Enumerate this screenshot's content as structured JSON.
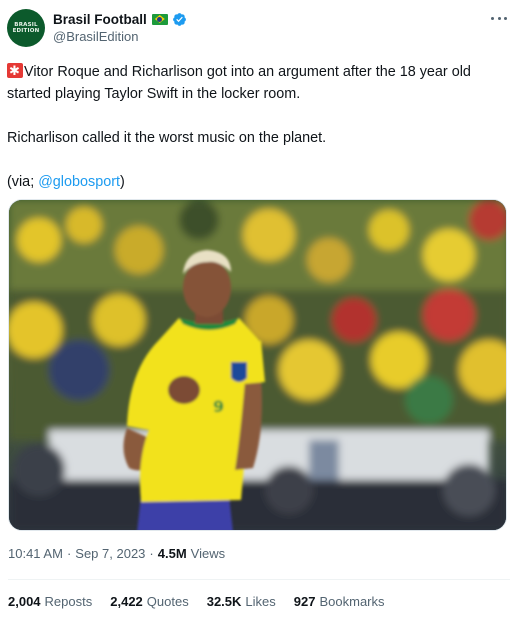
{
  "author": {
    "display_name": "Brasil Football",
    "handle": "@BrasilEdition",
    "avatar_text": "BRASIL EDITION",
    "flag_icon": "brazil-flag-icon",
    "verified_icon": "verified-badge-icon",
    "verified_color": "#1d9bf0"
  },
  "tweet": {
    "line1_text": "Vitor Roque and Richarlison got into an argument after the 18 year old started playing Taylor Swift in the locker room.",
    "line2_text": "Richarlison called it the worst music on the planet.",
    "via_prefix": "(via; ",
    "via_mention": "@globosport",
    "via_suffix": ")",
    "siren_icon": "siren-icon",
    "mention_color": "#1d9bf0"
  },
  "media": {
    "description_icon": "photo-footballer-yellow-jersey",
    "jersey_number": "9"
  },
  "meta": {
    "time": "10:41 AM",
    "date": "Sep 7, 2023",
    "separator": "·",
    "views_count": "4.5M",
    "views_label": "Views"
  },
  "stats": [
    {
      "count": "2,004",
      "label": "Reposts"
    },
    {
      "count": "2,422",
      "label": "Quotes"
    },
    {
      "count": "32.5K",
      "label": "Likes"
    },
    {
      "count": "927",
      "label": "Bookmarks"
    }
  ]
}
